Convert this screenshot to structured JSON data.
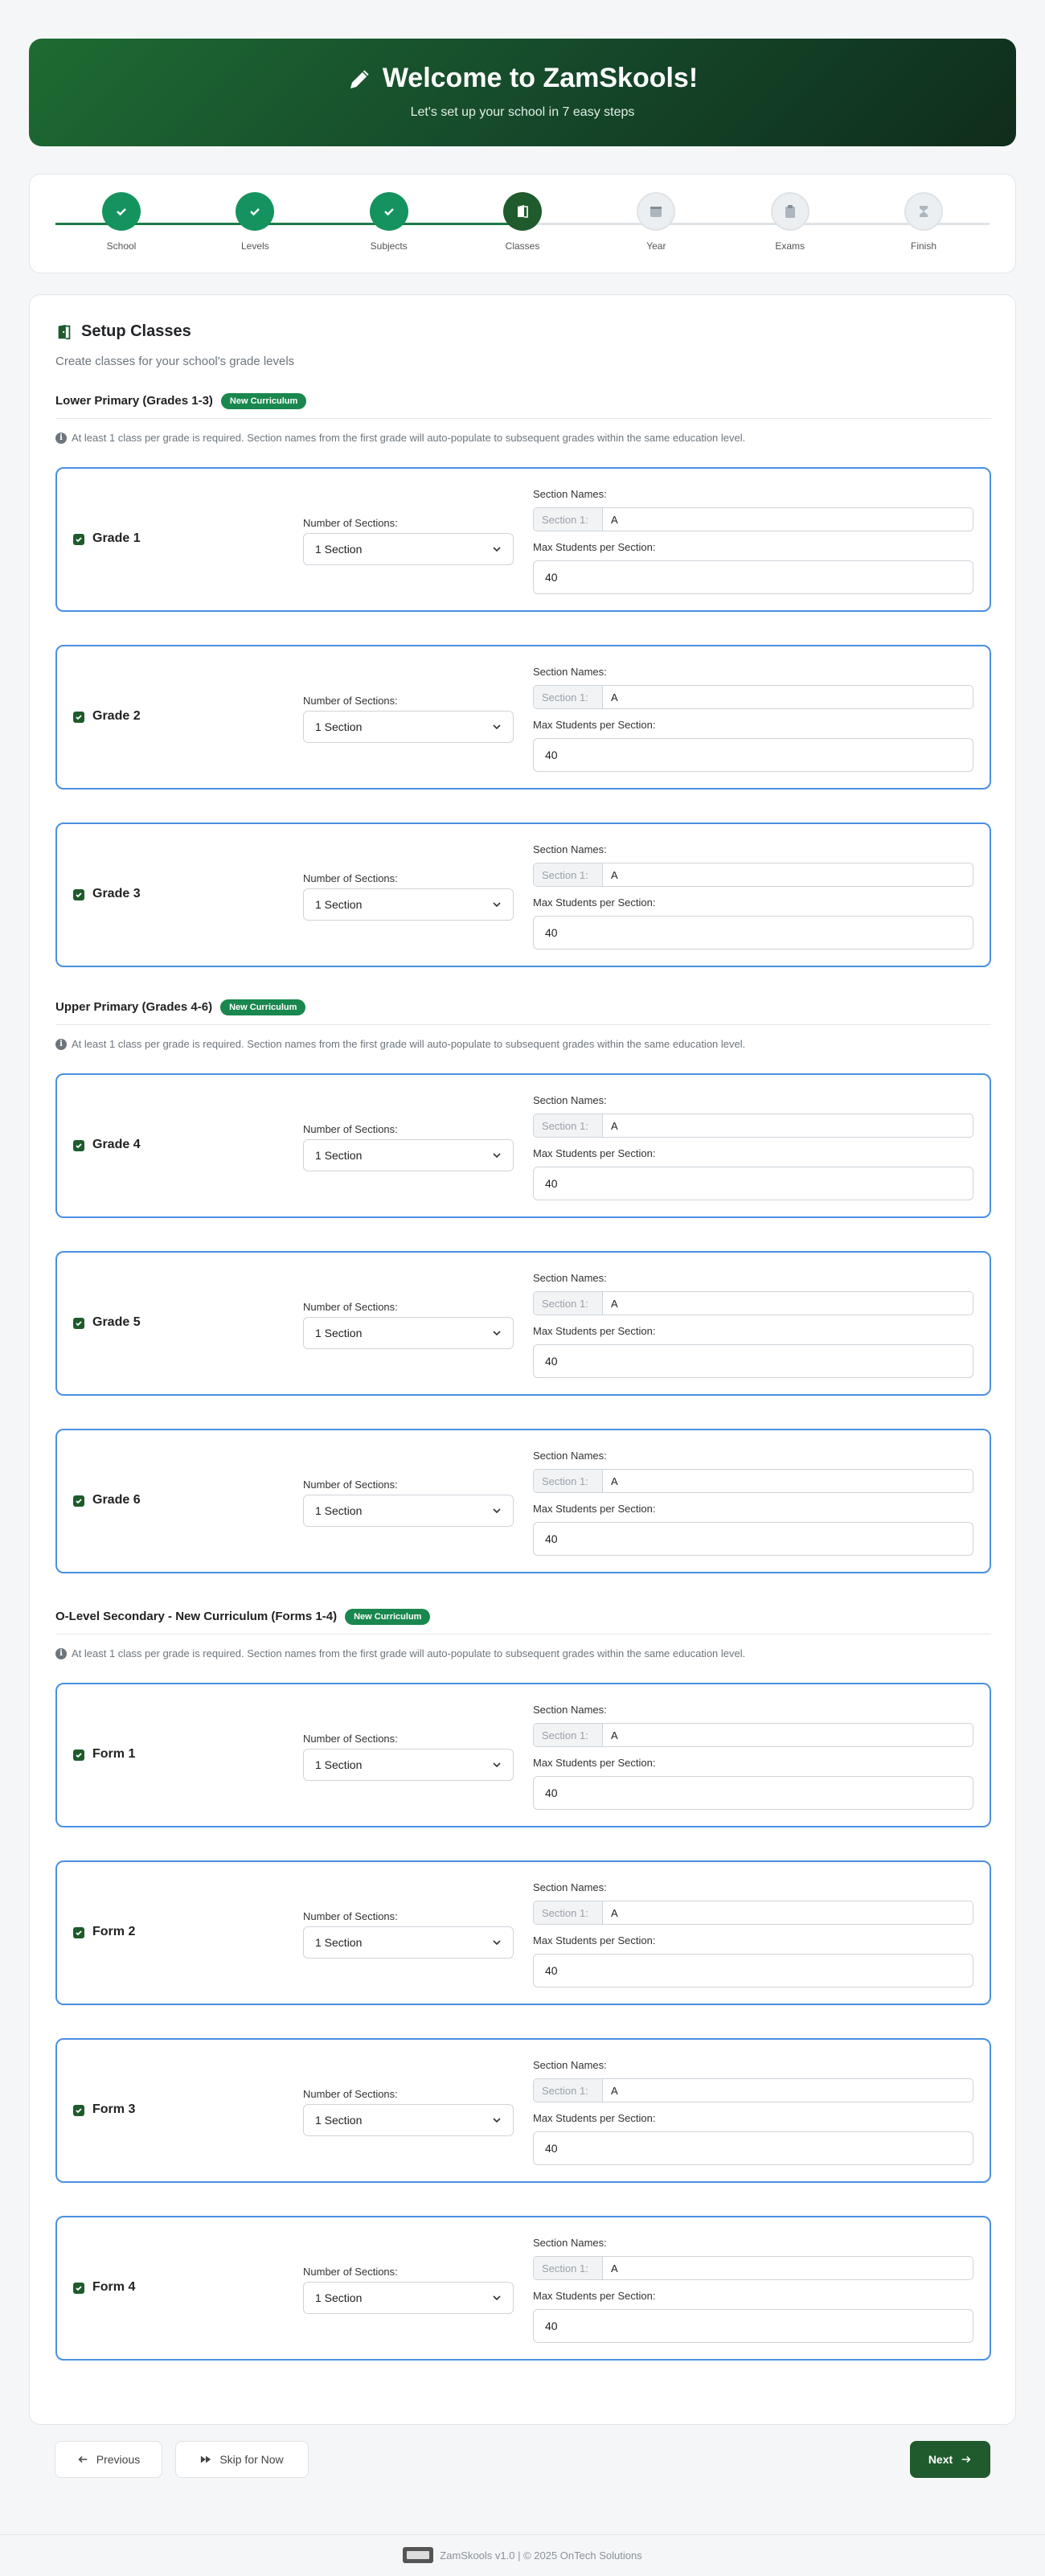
{
  "header": {
    "title": "Welcome to ZamSkools!",
    "subtitle": "Let's set up your school in 7 easy steps",
    "icon": "pencil-icon",
    "gradient": [
      "#1e6b32",
      "#0f2d1b"
    ]
  },
  "stepper": {
    "progress": 0.5,
    "steps": [
      {
        "label": "School",
        "state": "done"
      },
      {
        "label": "Levels",
        "state": "done"
      },
      {
        "label": "Subjects",
        "state": "done"
      },
      {
        "label": "Classes",
        "state": "active"
      },
      {
        "label": "Year",
        "state": "todo"
      },
      {
        "label": "Exams",
        "state": "todo"
      },
      {
        "label": "Finish",
        "state": "todo"
      }
    ]
  },
  "setup": {
    "title": "Setup Classes",
    "subtitle": "Create classes for your school's grade levels",
    "levels": [
      {
        "name": "Lower Primary (Grades 1-3)",
        "badge": "New Curriculum",
        "note": "At least 1 class per grade is required. Section names from the first grade will auto-populate to subsequent grades within the same education level.",
        "grades": [
          {
            "name": "Grade 1",
            "checked": true,
            "sections_label": "Number of Sections:",
            "sections": "1 Section",
            "section_names_label": "Section Names:",
            "section_prefix": "Section 1:",
            "section_value": "A",
            "max_label": "Max Students per Section:",
            "max": "40"
          },
          {
            "name": "Grade 2",
            "checked": true,
            "sections_label": "Number of Sections:",
            "sections": "1 Section",
            "section_names_label": "Section Names:",
            "section_prefix": "Section 1:",
            "section_value": "A",
            "max_label": "Max Students per Section:",
            "max": "40"
          },
          {
            "name": "Grade 3",
            "checked": true,
            "sections_label": "Number of Sections:",
            "sections": "1 Section",
            "section_names_label": "Section Names:",
            "section_prefix": "Section 1:",
            "section_value": "A",
            "max_label": "Max Students per Section:",
            "max": "40"
          }
        ]
      },
      {
        "name": "Upper Primary (Grades 4-6)",
        "badge": "New Curriculum",
        "note": "At least 1 class per grade is required. Section names from the first grade will auto-populate to subsequent grades within the same education level.",
        "grades": [
          {
            "name": "Grade 4",
            "checked": true,
            "sections_label": "Number of Sections:",
            "sections": "1 Section",
            "section_names_label": "Section Names:",
            "section_prefix": "Section 1:",
            "section_value": "A",
            "max_label": "Max Students per Section:",
            "max": "40"
          },
          {
            "name": "Grade 5",
            "checked": true,
            "sections_label": "Number of Sections:",
            "sections": "1 Section",
            "section_names_label": "Section Names:",
            "section_prefix": "Section 1:",
            "section_value": "A",
            "max_label": "Max Students per Section:",
            "max": "40"
          },
          {
            "name": "Grade 6",
            "checked": true,
            "sections_label": "Number of Sections:",
            "sections": "1 Section",
            "section_names_label": "Section Names:",
            "section_prefix": "Section 1:",
            "section_value": "A",
            "max_label": "Max Students per Section:",
            "max": "40"
          }
        ]
      },
      {
        "name": "O-Level Secondary - New Curriculum (Forms 1-4)",
        "badge": "New Curriculum",
        "note": "At least 1 class per grade is required. Section names from the first grade will auto-populate to subsequent grades within the same education level.",
        "grades": [
          {
            "name": "Form 1",
            "checked": true,
            "sections_label": "Number of Sections:",
            "sections": "1 Section",
            "section_names_label": "Section Names:",
            "section_prefix": "Section 1:",
            "section_value": "A",
            "max_label": "Max Students per Section:",
            "max": "40"
          },
          {
            "name": "Form 2",
            "checked": true,
            "sections_label": "Number of Sections:",
            "sections": "1 Section",
            "section_names_label": "Section Names:",
            "section_prefix": "Section 1:",
            "section_value": "A",
            "max_label": "Max Students per Section:",
            "max": "40"
          },
          {
            "name": "Form 3",
            "checked": true,
            "sections_label": "Number of Sections:",
            "sections": "1 Section",
            "section_names_label": "Section Names:",
            "section_prefix": "Section 1:",
            "section_value": "A",
            "max_label": "Max Students per Section:",
            "max": "40"
          },
          {
            "name": "Form 4",
            "checked": true,
            "sections_label": "Number of Sections:",
            "sections": "1 Section",
            "section_names_label": "Section Names:",
            "section_prefix": "Section 1:",
            "section_value": "A",
            "max_label": "Max Students per Section:",
            "max": "40"
          }
        ]
      }
    ]
  },
  "nav": {
    "previous": "Previous",
    "skip": "Skip for Now",
    "next": "Next"
  },
  "footer": {
    "text": "ZamSkools v1.0 | © 2025 OnTech Solutions"
  },
  "colors": {
    "brand": "#1f5b2c",
    "done": "#15935e",
    "badge": "#19874e",
    "card_border": "#4a90e2"
  }
}
